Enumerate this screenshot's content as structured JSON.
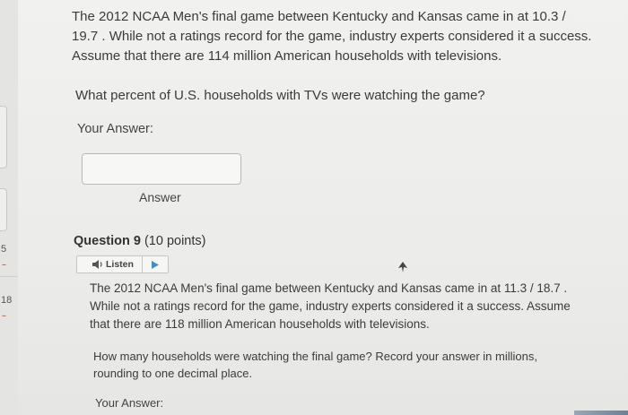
{
  "left_nav": {
    "num_a": "5",
    "num_b": "18",
    "dash": "--"
  },
  "question_8": {
    "text": "The 2012 NCAA Men's final game between Kentucky and Kansas came in at 10.3 / 19.7 . While not a ratings record for the game, industry experts considered it a success. Assume that there are 114 million American households with televisions.",
    "prompt": "What percent of U.S. households with TVs were watching the game?",
    "your_answer_label": "Your Answer:",
    "answer_value": "",
    "answer_caption": "Answer"
  },
  "question_9": {
    "title": "Question 9",
    "points": "(10 points)",
    "listen_label": "Listen",
    "text": "The 2012 NCAA Men's final game between Kentucky and Kansas came in at 11.3 / 18.7 . While not a ratings record for the game, industry experts considered it a success. Assume that there are 118 million American households with televisions.",
    "prompt": "How many households were watching the final game? Record your answer in millions, rounding to one decimal place.",
    "your_answer_label": "Your Answer:"
  },
  "colors": {
    "background": "#ececea",
    "text": "#3b3b3b",
    "accent_dash": "#c0392b"
  },
  "icons": [
    "speaker-icon",
    "play-icon",
    "cursor-icon"
  ]
}
